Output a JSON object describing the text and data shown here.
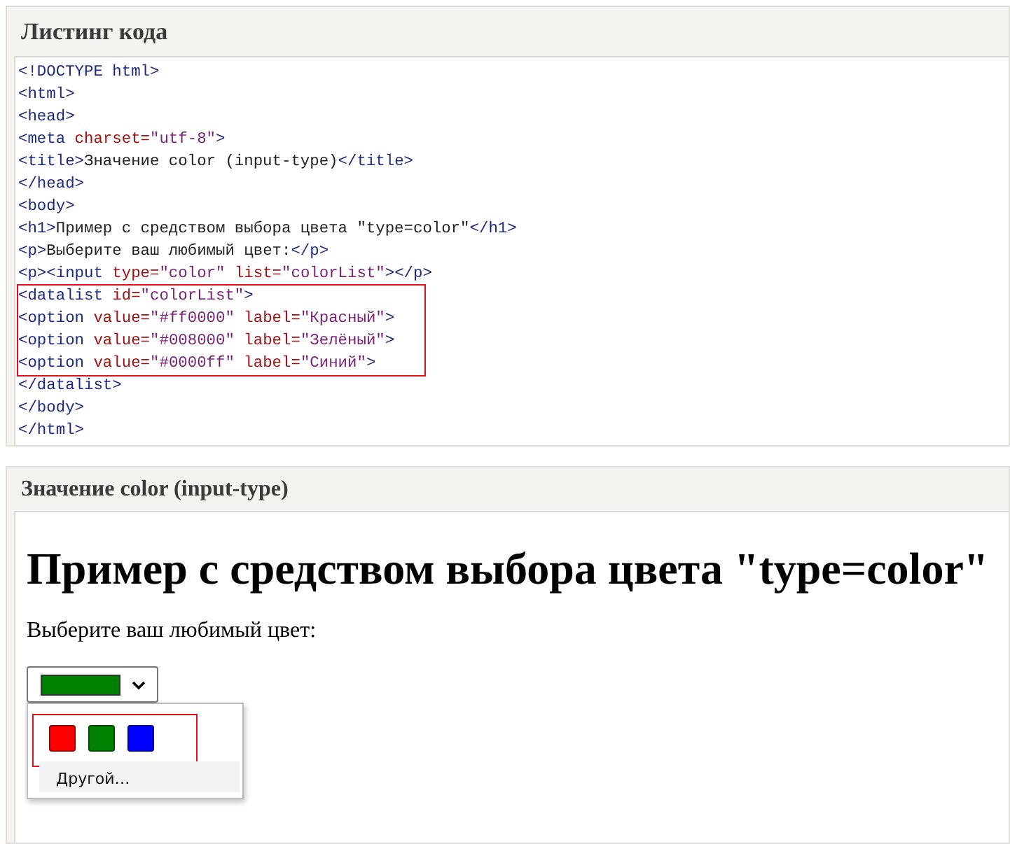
{
  "listing": {
    "title": "Листинг кода",
    "lines": [
      {
        "highlighted": false,
        "tokens": [
          {
            "kind": "tag",
            "text": "<!DOCTYPE html>"
          }
        ]
      },
      {
        "highlighted": false,
        "tokens": [
          {
            "kind": "tag",
            "text": "<html>"
          }
        ]
      },
      {
        "highlighted": false,
        "tokens": [
          {
            "kind": "tag",
            "text": "<head>"
          }
        ]
      },
      {
        "highlighted": false,
        "tokens": [
          {
            "kind": "tag",
            "text": "<meta "
          },
          {
            "kind": "attr",
            "text": "charset="
          },
          {
            "kind": "value",
            "text": "\"utf-8\""
          },
          {
            "kind": "tag",
            "text": ">"
          }
        ]
      },
      {
        "highlighted": false,
        "tokens": [
          {
            "kind": "tag",
            "text": "<title>"
          },
          {
            "kind": "text",
            "text": "Значение color (input-type)"
          },
          {
            "kind": "tag",
            "text": "</title>"
          }
        ]
      },
      {
        "highlighted": false,
        "tokens": [
          {
            "kind": "tag",
            "text": "</head>"
          }
        ]
      },
      {
        "highlighted": false,
        "tokens": [
          {
            "kind": "tag",
            "text": "<body>"
          }
        ]
      },
      {
        "highlighted": false,
        "tokens": [
          {
            "kind": "tag",
            "text": "<h1>"
          },
          {
            "kind": "text",
            "text": "Пример с средством выбора цвета \"type=color\""
          },
          {
            "kind": "tag",
            "text": "</h1>"
          }
        ]
      },
      {
        "highlighted": false,
        "tokens": [
          {
            "kind": "tag",
            "text": "<p>"
          },
          {
            "kind": "text",
            "text": "Выберите ваш любимый цвет:"
          },
          {
            "kind": "tag",
            "text": "</p>"
          }
        ]
      },
      {
        "highlighted": false,
        "tokens": [
          {
            "kind": "tag",
            "text": "<p><input "
          },
          {
            "kind": "attr",
            "text": "type="
          },
          {
            "kind": "value",
            "text": "\"color\" "
          },
          {
            "kind": "attr",
            "text": "list="
          },
          {
            "kind": "value",
            "text": "\"colorList\""
          },
          {
            "kind": "tag",
            "text": "></p>"
          }
        ]
      },
      {
        "highlighted": true,
        "tokens": [
          {
            "kind": "tag",
            "text": "<datalist "
          },
          {
            "kind": "attr",
            "text": "id="
          },
          {
            "kind": "value",
            "text": "\"colorList\""
          },
          {
            "kind": "tag",
            "text": ">"
          }
        ]
      },
      {
        "highlighted": true,
        "tokens": [
          {
            "kind": "tag",
            "text": "<option "
          },
          {
            "kind": "attr",
            "text": "value="
          },
          {
            "kind": "value",
            "text": "\"#ff0000\" "
          },
          {
            "kind": "attr",
            "text": "label="
          },
          {
            "kind": "value",
            "text": "\"Красный\""
          },
          {
            "kind": "tag",
            "text": ">"
          }
        ]
      },
      {
        "highlighted": true,
        "tokens": [
          {
            "kind": "tag",
            "text": "<option "
          },
          {
            "kind": "attr",
            "text": "value="
          },
          {
            "kind": "value",
            "text": "\"#008000\" "
          },
          {
            "kind": "attr",
            "text": "label="
          },
          {
            "kind": "value",
            "text": "\"Зелёный\""
          },
          {
            "kind": "tag",
            "text": ">"
          }
        ]
      },
      {
        "highlighted": true,
        "tokens": [
          {
            "kind": "tag",
            "text": "<option "
          },
          {
            "kind": "attr",
            "text": "value="
          },
          {
            "kind": "value",
            "text": "\"#0000ff\" "
          },
          {
            "kind": "attr",
            "text": "label="
          },
          {
            "kind": "value",
            "text": "\"Синий\""
          },
          {
            "kind": "tag",
            "text": ">"
          }
        ]
      },
      {
        "highlighted": false,
        "tokens": [
          {
            "kind": "tag",
            "text": "</datalist>"
          }
        ]
      },
      {
        "highlighted": false,
        "tokens": [
          {
            "kind": "tag",
            "text": "</body>"
          }
        ]
      },
      {
        "highlighted": false,
        "tokens": [
          {
            "kind": "tag",
            "text": "</html>"
          }
        ]
      }
    ]
  },
  "result": {
    "title": "Значение color (input-type)",
    "heading": "Пример с средством выбора цвета \"type=color\"",
    "paragraph": "Выберите ваш любимый цвет:",
    "color_input": {
      "color": "#008000",
      "expanded": true
    },
    "popup": {
      "swatches_highlighted": true,
      "swatches": [
        {
          "color": "#ff0000"
        },
        {
          "color": "#008000"
        },
        {
          "color": "#0000ff"
        }
      ],
      "other_button": "Другой…"
    }
  }
}
